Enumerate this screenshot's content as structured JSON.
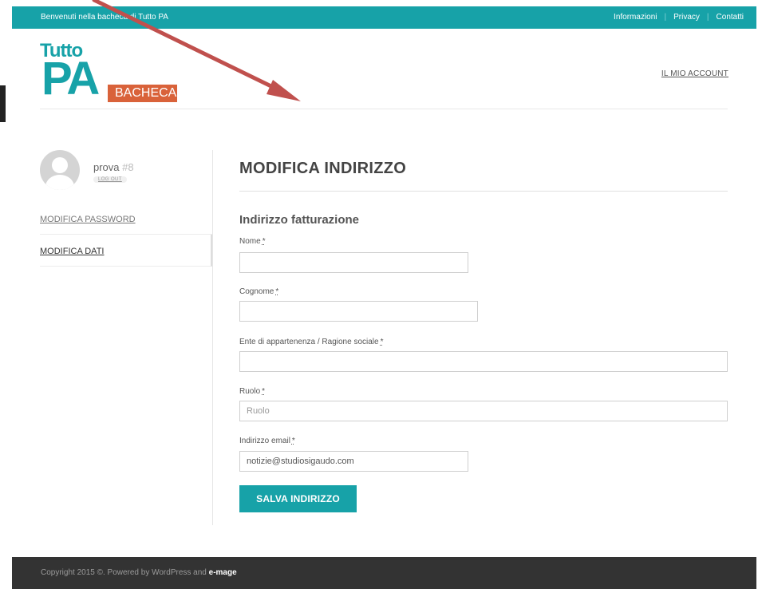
{
  "topbar": {
    "welcome": "Benvenuti nella bacheca di Tutto PA",
    "links": [
      "Informazioni",
      "Privacy",
      "Contatti"
    ]
  },
  "logo": {
    "line1": "Tutto",
    "line2": "PA",
    "tag": "BACHECA"
  },
  "header": {
    "account_link": "IL MIO ACCOUNT"
  },
  "user": {
    "name": "prova",
    "id": "#8",
    "logout": "LOG OUT"
  },
  "sidebar": {
    "items": [
      {
        "label": "MODIFICA PASSWORD"
      },
      {
        "label": "MODIFICA DATI"
      }
    ]
  },
  "main": {
    "title": "MODIFICA INDIRIZZO",
    "section": "Indirizzo fatturazione",
    "fields": {
      "nome": {
        "label": "Nome",
        "req": "*",
        "value": "",
        "placeholder": ""
      },
      "cognome": {
        "label": "Cognome",
        "req": "*",
        "value": "",
        "placeholder": ""
      },
      "ente": {
        "label": "Ente di appartenenza / Ragione sociale",
        "req": "*",
        "value": "",
        "placeholder": ""
      },
      "ruolo": {
        "label": "Ruolo",
        "req": "*",
        "value": "",
        "placeholder": "Ruolo"
      },
      "email": {
        "label": "Indirizzo email",
        "req": "*",
        "value": "notizie@studiosigaudo.com",
        "placeholder": ""
      }
    },
    "save_label": "SALVA INDIRIZZO"
  },
  "footer": {
    "text": "Copyright 2015 ©. Powered by WordPress and",
    "brand": "e-mage"
  },
  "colors": {
    "accent": "#17a2a8",
    "bacheca": "#d9623a",
    "arrow": "#c0504d",
    "footer": "#333333"
  }
}
